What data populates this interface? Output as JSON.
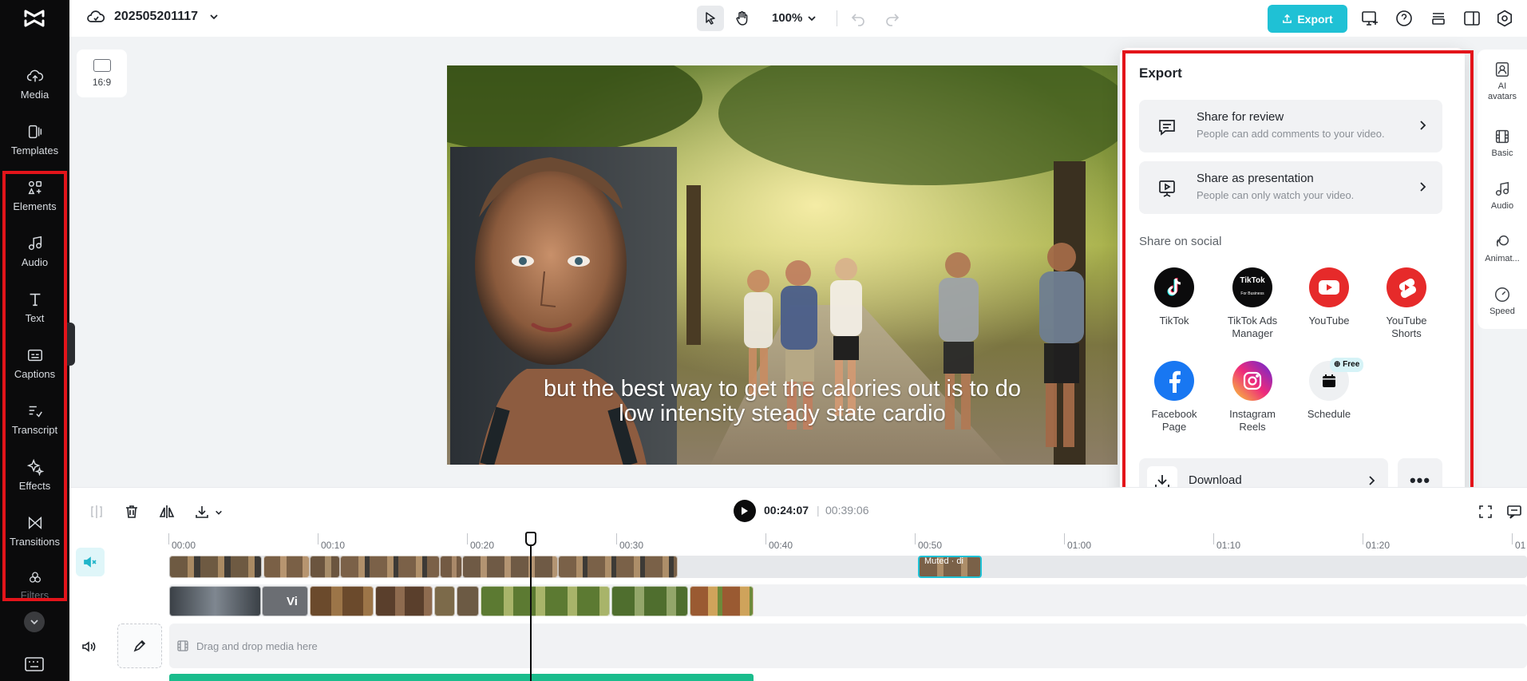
{
  "app": {
    "project_name": "202505201117",
    "zoom_level": "100%"
  },
  "sidebar": {
    "items": [
      {
        "label": "Media",
        "icon": "cloud-upload-icon"
      },
      {
        "label": "Templates",
        "icon": "templates-icon"
      },
      {
        "label": "Elements",
        "icon": "elements-icon"
      },
      {
        "label": "Audio",
        "icon": "music-note-icon"
      },
      {
        "label": "Text",
        "icon": "text-icon"
      },
      {
        "label": "Captions",
        "icon": "captions-icon"
      },
      {
        "label": "Transcript",
        "icon": "transcript-icon"
      },
      {
        "label": "Effects",
        "icon": "sparkle-icon"
      },
      {
        "label": "Transitions",
        "icon": "transitions-icon"
      },
      {
        "label": "Filters",
        "icon": "filters-icon"
      }
    ]
  },
  "topbar": {
    "export_label": "Export"
  },
  "canvas": {
    "aspect_ratio": "16:9",
    "caption_line1": "but the best way to get the calories out is to do",
    "caption_line2": "low intensity steady state cardio"
  },
  "rightbar": {
    "items": [
      {
        "label": "AI avatars",
        "icon": "ai-avatar-icon"
      },
      {
        "label": "Basic",
        "icon": "basic-film-icon"
      },
      {
        "label": "Audio",
        "icon": "music-note-icon"
      },
      {
        "label": "Animat...",
        "icon": "animation-icon"
      },
      {
        "label": "Speed",
        "icon": "speed-gauge-icon"
      }
    ]
  },
  "export_panel": {
    "title": "Export",
    "share_review": {
      "title": "Share for review",
      "subtitle": "People can add comments to your video."
    },
    "share_presentation": {
      "title": "Share as presentation",
      "subtitle": "People can only watch your video."
    },
    "social_title": "Share on social",
    "socials": [
      {
        "label": "TikTok",
        "color": "#0b0b0c"
      },
      {
        "label": "TikTok Ads Manager",
        "logo_text": "TikTok",
        "logo_sub": "For Business",
        "color": "#0b0b0c"
      },
      {
        "label": "YouTube",
        "color": "#e62a2a"
      },
      {
        "label": "YouTube Shorts",
        "color": "#e62a2a"
      },
      {
        "label": "Facebook Page",
        "color": "#1877f2"
      },
      {
        "label": "Instagram Reels",
        "color": "#d62976"
      },
      {
        "label": "Schedule",
        "badge": "Free",
        "color": "#eef0f2"
      }
    ],
    "download_label": "Download",
    "more_label": "•••"
  },
  "timeline": {
    "current_time": "00:24:07",
    "separator": "|",
    "total_time": "00:39:06",
    "ruler_labels": [
      "00:00",
      "00:10",
      "00:20",
      "00:30",
      "00:40",
      "00:50",
      "01:00",
      "01:10",
      "01:20",
      "01"
    ],
    "muted_clip_label": "Muted · di",
    "video_clip_label": "Vi",
    "drop_zone_text": "Drag and drop media here"
  }
}
